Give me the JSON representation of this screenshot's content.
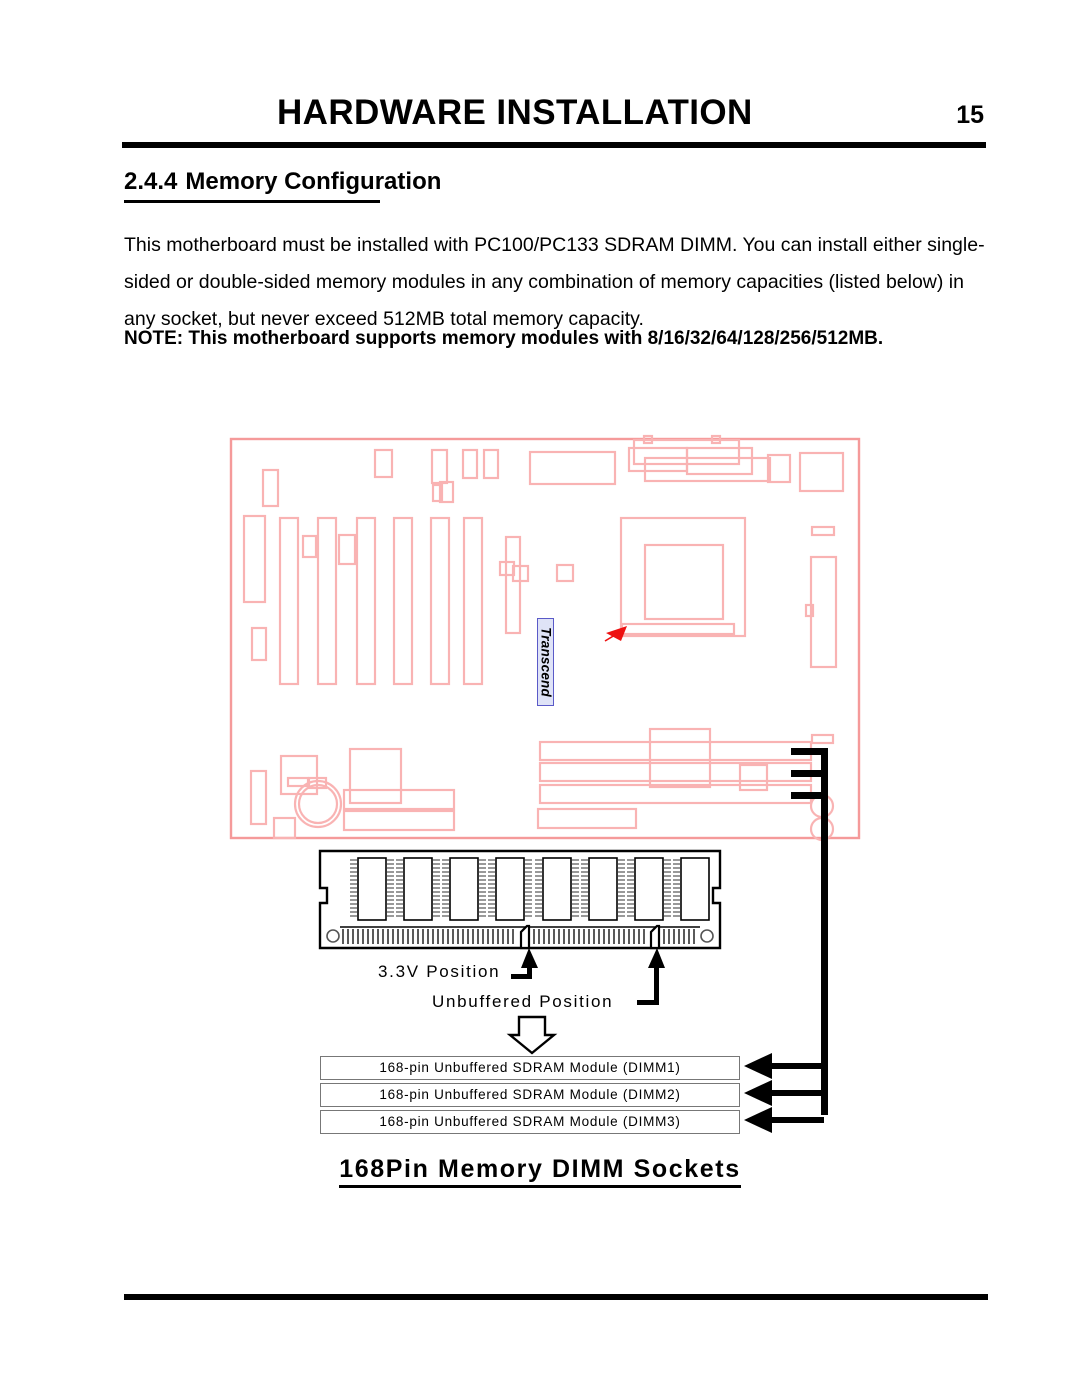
{
  "header": {
    "title": "HARDWARE INSTALLATION",
    "page_number": "15"
  },
  "section": {
    "number": "2.4.4",
    "title": "Memory Configuration"
  },
  "body": {
    "paragraph": "This motherboard must be installed with PC100/PC133 SDRAM DIMM.  You can install either single-sided or double-sided memory modules in any combination of memory capacities (listed below) in any socket, but never exceed 512MB total memory capacity.",
    "note": "NOTE:  This motherboard supports memory modules with 8/16/32/64/128/256/512MB."
  },
  "figure": {
    "caption": "168Pin  Memory DIMM Sockets",
    "brand_tag": "Transcend",
    "callouts": [
      {
        "id": "voltage-position",
        "label": "3.3V Position"
      },
      {
        "id": "buffer-position",
        "label": "Unbuffered Position"
      }
    ],
    "dimm_sockets": [
      {
        "label": "168-pin Unbuffered SDRAM Module (DIMM1)"
      },
      {
        "label": "168-pin Unbuffered SDRAM Module (DIMM2)"
      },
      {
        "label": "168-pin Unbuffered SDRAM Module (DIMM3)"
      }
    ],
    "colors": {
      "board_outline": "#f59a9a",
      "board_component": "#f9b3b3",
      "arrow_red": "#ee1111",
      "pointer_black": "#000000",
      "brand_tag_bg": "#dfe3f7",
      "brand_tag_border": "#5a5ac8"
    }
  }
}
